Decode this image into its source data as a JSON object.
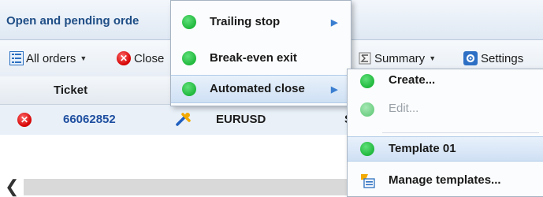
{
  "panel": {
    "title": "Open and pending orde"
  },
  "toolbar": {
    "all_orders_label": "All orders",
    "close_label": "Close",
    "summary_label": "Summary",
    "settings_label": "Settings"
  },
  "table": {
    "columns": [
      "Ticket"
    ],
    "rows": [
      {
        "ticket": "66062852",
        "symbol": "EURUSD",
        "extra": "S"
      }
    ]
  },
  "menu_main": {
    "items": [
      {
        "label": "Trailing stop",
        "submenu": true
      },
      {
        "label": "Break-even exit",
        "submenu": false
      },
      {
        "label": "Automated close",
        "submenu": true,
        "highlighted": true
      }
    ]
  },
  "menu_sub": {
    "items": [
      {
        "label": "Create..."
      },
      {
        "label": "Edit...",
        "disabled": true
      },
      {
        "label": "Template 01",
        "highlighted": true
      },
      {
        "label": "Manage templates..."
      }
    ]
  },
  "colors": {
    "accent": "#1f4e86",
    "status_green": "#20b83c",
    "close_red": "#d40000"
  },
  "icons": [
    "all-orders-icon",
    "close-icon",
    "summary-icon",
    "settings-icon",
    "wrench-icon",
    "manage-templates-icon",
    "chevron-left-icon"
  ]
}
